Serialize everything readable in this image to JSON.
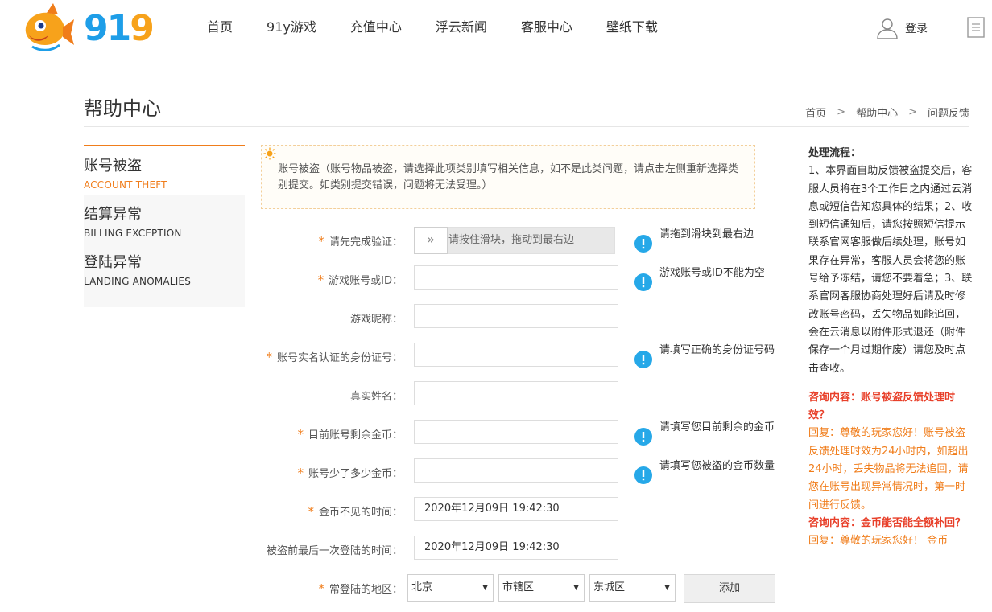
{
  "header": {
    "logo_text": "919",
    "nav": [
      "首页",
      "91y游戏",
      "充值中心",
      "浮云新闻",
      "客服中心",
      "壁纸下载"
    ],
    "login_label": "登录"
  },
  "page": {
    "title": "帮助中心",
    "breadcrumb": [
      "首页",
      "帮助中心",
      "问题反馈"
    ],
    "breadcrumb_sep": ">"
  },
  "left_menu": [
    {
      "cn": "账号被盗",
      "en": "ACCOUNT THEFT",
      "active": true
    },
    {
      "cn": "结算异常",
      "en": "BILLING EXCEPTION",
      "active": false
    },
    {
      "cn": "登陆异常",
      "en": "LANDING ANOMALIES",
      "active": false
    }
  ],
  "notice": {
    "text": "账号被盗（账号物品被盗，请选择此项类别填写相关信息，如不是此类问题，请点击左侧重新选择类别提交。如类别提交错误，问题将无法受理。）"
  },
  "form": {
    "required_mark": "*",
    "verify": {
      "label": "请先完成验证：",
      "slider_handle": "»",
      "slider_text": "请按住滑块，拖动到最右边",
      "hint": "请拖到滑块到最右边"
    },
    "account": {
      "label": "游戏账号或ID：",
      "value": "",
      "hint": "游戏账号或ID不能为空"
    },
    "nickname": {
      "label": "游戏昵称：",
      "value": ""
    },
    "idcard": {
      "label": "账号实名认证的身份证号：",
      "value": "",
      "hint": "请填写正确的身份证号码"
    },
    "realname": {
      "label": "真实姓名：",
      "value": ""
    },
    "coins_left": {
      "label": "目前账号剩余金币：",
      "value": "",
      "hint": "请填写您目前剩余的金币"
    },
    "coins_lost": {
      "label": "账号少了多少金币：",
      "value": "",
      "hint": "请填写您被盗的金币数量"
    },
    "lost_time": {
      "label": "金币不见的时间：",
      "value": "2020年12月09日 19:42:30"
    },
    "last_login": {
      "label": "被盗前最后一次登陆的时间：",
      "value": "2020年12月09日 19:42:30"
    },
    "region": {
      "label": "常登陆的地区：",
      "province": "北京",
      "district": "市辖区",
      "area": "东城区",
      "add_label": "添加"
    }
  },
  "right_panel": {
    "proc_title": "处理流程：",
    "proc_text": "1、本界面自助反馈被盗提交后，客服人员将在3个工作日之内通过云消息或短信告知您具体的结果；2、收到短信通知后，请您按照短信提示联系官网客服做后续处理，账号如果存在异常，客服人员会将您的账号给予冻结，请您不要着急；3、联系官网客服协商处理好后请及时修改账号密码，丢失物品如能追回，会在云消息以附件形式退还（附件保存一个月过期作废）请您及时点击查收。",
    "faq": [
      {
        "q": "咨询内容：账号被盗反馈处理时效？",
        "a": "回复：尊敬的玩家您好！账号被盗反馈处理时效为24小时内，如超出24小时，丢失物品将无法追回，请您在账号出现异常情况时，第一时间进行反馈。"
      },
      {
        "q": "咨询内容：金币能否能全额补回？",
        "a": "回复：尊敬的玩家您好！ 金币"
      }
    ]
  },
  "colors": {
    "accent": "#f07d1b",
    "logo_blue": "#1e9ee8",
    "logo_orange": "#f7a21b",
    "info_blue": "#26a8e8",
    "faq_red": "#e8402a"
  }
}
